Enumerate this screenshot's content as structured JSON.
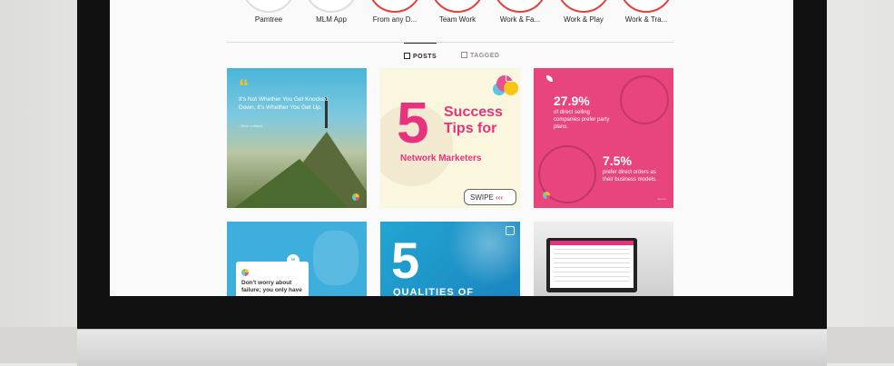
{
  "highlights": [
    {
      "label": "Pamtree",
      "ring": "gray"
    },
    {
      "label": "MLM App",
      "ring": "gray"
    },
    {
      "label": "From any D...",
      "ring": "red"
    },
    {
      "label": "Team Work",
      "ring": "red"
    },
    {
      "label": "Work & Fa...",
      "ring": "red"
    },
    {
      "label": "Work & Play",
      "ring": "red"
    },
    {
      "label": "Work & Tra...",
      "ring": "red"
    }
  ],
  "tabs": [
    {
      "label": "POSTS",
      "active": true,
      "icon": "grid-icon"
    },
    {
      "label": "TAGGED",
      "active": false,
      "icon": "tag-icon"
    }
  ],
  "posts": [
    {
      "quote_mark": "“",
      "text": "It's Not Whether You Get Knocked Down, It's Whether You Get Up.",
      "author": "- Vince Lombardi"
    },
    {
      "number": "5",
      "title": "Success Tips for",
      "subtitle": "Network Marketers",
      "swipe": "SWIPE",
      "arrows": "‹‹‹"
    },
    {
      "stat1_value": "27.9%",
      "stat1_desc": "of direct selling companies prefer party plans.",
      "stat2_value": "7.5%",
      "stat2_desc": "prefer direct orders as their business models.",
      "small": "Source"
    },
    {
      "quote_mark": "“",
      "text": "Don't worry about failure; you only have"
    },
    {
      "number": "5",
      "title": "QUALITIES OF"
    },
    {
      "description": "laptop dashboard photo"
    }
  ],
  "colors": {
    "pink": "#e8327d",
    "blue": "#3eaedd",
    "yellow": "#f5c518"
  }
}
